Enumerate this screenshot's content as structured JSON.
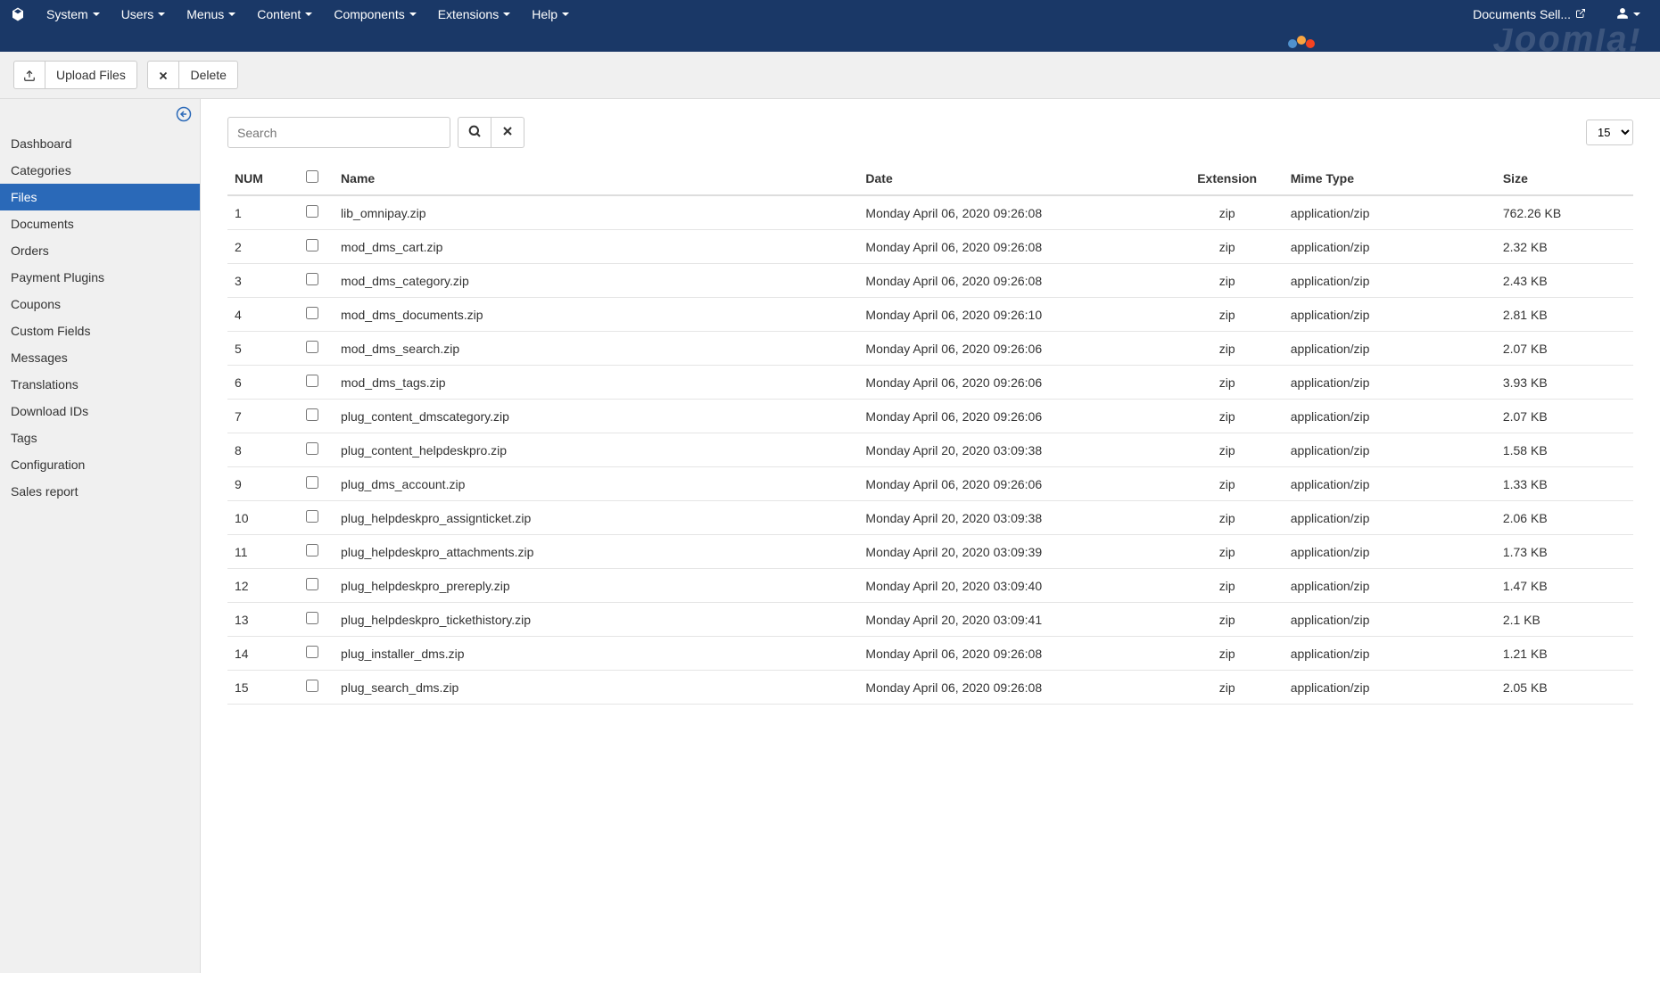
{
  "navbar": {
    "items": [
      {
        "label": "System"
      },
      {
        "label": "Users"
      },
      {
        "label": "Menus"
      },
      {
        "label": "Content"
      },
      {
        "label": "Components"
      },
      {
        "label": "Extensions"
      },
      {
        "label": "Help"
      }
    ],
    "site_link": "Documents Sell..."
  },
  "toolbar": {
    "upload_label": "Upload Files",
    "delete_label": "Delete"
  },
  "sidebar": {
    "items": [
      {
        "label": "Dashboard"
      },
      {
        "label": "Categories"
      },
      {
        "label": "Files"
      },
      {
        "label": "Documents"
      },
      {
        "label": "Orders"
      },
      {
        "label": "Payment Plugins"
      },
      {
        "label": "Coupons"
      },
      {
        "label": "Custom Fields"
      },
      {
        "label": "Messages"
      },
      {
        "label": "Translations"
      },
      {
        "label": "Download IDs"
      },
      {
        "label": "Tags"
      },
      {
        "label": "Configuration"
      },
      {
        "label": "Sales report"
      }
    ],
    "active_index": 2
  },
  "search": {
    "placeholder": "Search"
  },
  "limit": {
    "value": "15"
  },
  "table": {
    "headers": {
      "num": "NUM",
      "name": "Name",
      "date": "Date",
      "extension": "Extension",
      "mime": "Mime Type",
      "size": "Size"
    },
    "rows": [
      {
        "num": "1",
        "name": "lib_omnipay.zip",
        "date": "Monday April 06, 2020 09:26:08",
        "ext": "zip",
        "mime": "application/zip",
        "size": "762.26 KB"
      },
      {
        "num": "2",
        "name": "mod_dms_cart.zip",
        "date": "Monday April 06, 2020 09:26:08",
        "ext": "zip",
        "mime": "application/zip",
        "size": "2.32 KB"
      },
      {
        "num": "3",
        "name": "mod_dms_category.zip",
        "date": "Monday April 06, 2020 09:26:08",
        "ext": "zip",
        "mime": "application/zip",
        "size": "2.43 KB"
      },
      {
        "num": "4",
        "name": "mod_dms_documents.zip",
        "date": "Monday April 06, 2020 09:26:10",
        "ext": "zip",
        "mime": "application/zip",
        "size": "2.81 KB"
      },
      {
        "num": "5",
        "name": "mod_dms_search.zip",
        "date": "Monday April 06, 2020 09:26:06",
        "ext": "zip",
        "mime": "application/zip",
        "size": "2.07 KB"
      },
      {
        "num": "6",
        "name": "mod_dms_tags.zip",
        "date": "Monday April 06, 2020 09:26:06",
        "ext": "zip",
        "mime": "application/zip",
        "size": "3.93 KB"
      },
      {
        "num": "7",
        "name": "plug_content_dmscategory.zip",
        "date": "Monday April 06, 2020 09:26:06",
        "ext": "zip",
        "mime": "application/zip",
        "size": "2.07 KB"
      },
      {
        "num": "8",
        "name": "plug_content_helpdeskpro.zip",
        "date": "Monday April 20, 2020 03:09:38",
        "ext": "zip",
        "mime": "application/zip",
        "size": "1.58 KB"
      },
      {
        "num": "9",
        "name": "plug_dms_account.zip",
        "date": "Monday April 06, 2020 09:26:06",
        "ext": "zip",
        "mime": "application/zip",
        "size": "1.33 KB"
      },
      {
        "num": "10",
        "name": "plug_helpdeskpro_assignticket.zip",
        "date": "Monday April 20, 2020 03:09:38",
        "ext": "zip",
        "mime": "application/zip",
        "size": "2.06 KB"
      },
      {
        "num": "11",
        "name": "plug_helpdeskpro_attachments.zip",
        "date": "Monday April 20, 2020 03:09:39",
        "ext": "zip",
        "mime": "application/zip",
        "size": "1.73 KB"
      },
      {
        "num": "12",
        "name": "plug_helpdeskpro_prereply.zip",
        "date": "Monday April 20, 2020 03:09:40",
        "ext": "zip",
        "mime": "application/zip",
        "size": "1.47 KB"
      },
      {
        "num": "13",
        "name": "plug_helpdeskpro_tickethistory.zip",
        "date": "Monday April 20, 2020 03:09:41",
        "ext": "zip",
        "mime": "application/zip",
        "size": "2.1 KB"
      },
      {
        "num": "14",
        "name": "plug_installer_dms.zip",
        "date": "Monday April 06, 2020 09:26:08",
        "ext": "zip",
        "mime": "application/zip",
        "size": "1.21 KB"
      },
      {
        "num": "15",
        "name": "plug_search_dms.zip",
        "date": "Monday April 06, 2020 09:26:08",
        "ext": "zip",
        "mime": "application/zip",
        "size": "2.05 KB"
      }
    ]
  }
}
